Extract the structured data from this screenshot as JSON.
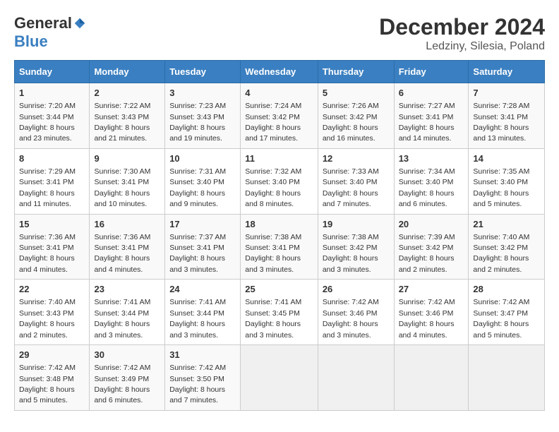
{
  "logo": {
    "general": "General",
    "blue": "Blue"
  },
  "title": "December 2024",
  "location": "Ledziny, Silesia, Poland",
  "days_of_week": [
    "Sunday",
    "Monday",
    "Tuesday",
    "Wednesday",
    "Thursday",
    "Friday",
    "Saturday"
  ],
  "weeks": [
    [
      {
        "day": "1",
        "sunrise": "7:20 AM",
        "sunset": "3:44 PM",
        "daylight": "8 hours and 23 minutes"
      },
      {
        "day": "2",
        "sunrise": "7:22 AM",
        "sunset": "3:43 PM",
        "daylight": "8 hours and 21 minutes"
      },
      {
        "day": "3",
        "sunrise": "7:23 AM",
        "sunset": "3:43 PM",
        "daylight": "8 hours and 19 minutes"
      },
      {
        "day": "4",
        "sunrise": "7:24 AM",
        "sunset": "3:42 PM",
        "daylight": "8 hours and 17 minutes"
      },
      {
        "day": "5",
        "sunrise": "7:26 AM",
        "sunset": "3:42 PM",
        "daylight": "8 hours and 16 minutes"
      },
      {
        "day": "6",
        "sunrise": "7:27 AM",
        "sunset": "3:41 PM",
        "daylight": "8 hours and 14 minutes"
      },
      {
        "day": "7",
        "sunrise": "7:28 AM",
        "sunset": "3:41 PM",
        "daylight": "8 hours and 13 minutes"
      }
    ],
    [
      {
        "day": "8",
        "sunrise": "7:29 AM",
        "sunset": "3:41 PM",
        "daylight": "8 hours and 11 minutes"
      },
      {
        "day": "9",
        "sunrise": "7:30 AM",
        "sunset": "3:41 PM",
        "daylight": "8 hours and 10 minutes"
      },
      {
        "day": "10",
        "sunrise": "7:31 AM",
        "sunset": "3:40 PM",
        "daylight": "8 hours and 9 minutes"
      },
      {
        "day": "11",
        "sunrise": "7:32 AM",
        "sunset": "3:40 PM",
        "daylight": "8 hours and 8 minutes"
      },
      {
        "day": "12",
        "sunrise": "7:33 AM",
        "sunset": "3:40 PM",
        "daylight": "8 hours and 7 minutes"
      },
      {
        "day": "13",
        "sunrise": "7:34 AM",
        "sunset": "3:40 PM",
        "daylight": "8 hours and 6 minutes"
      },
      {
        "day": "14",
        "sunrise": "7:35 AM",
        "sunset": "3:40 PM",
        "daylight": "8 hours and 5 minutes"
      }
    ],
    [
      {
        "day": "15",
        "sunrise": "7:36 AM",
        "sunset": "3:41 PM",
        "daylight": "8 hours and 4 minutes"
      },
      {
        "day": "16",
        "sunrise": "7:36 AM",
        "sunset": "3:41 PM",
        "daylight": "8 hours and 4 minutes"
      },
      {
        "day": "17",
        "sunrise": "7:37 AM",
        "sunset": "3:41 PM",
        "daylight": "8 hours and 3 minutes"
      },
      {
        "day": "18",
        "sunrise": "7:38 AM",
        "sunset": "3:41 PM",
        "daylight": "8 hours and 3 minutes"
      },
      {
        "day": "19",
        "sunrise": "7:38 AM",
        "sunset": "3:42 PM",
        "daylight": "8 hours and 3 minutes"
      },
      {
        "day": "20",
        "sunrise": "7:39 AM",
        "sunset": "3:42 PM",
        "daylight": "8 hours and 2 minutes"
      },
      {
        "day": "21",
        "sunrise": "7:40 AM",
        "sunset": "3:42 PM",
        "daylight": "8 hours and 2 minutes"
      }
    ],
    [
      {
        "day": "22",
        "sunrise": "7:40 AM",
        "sunset": "3:43 PM",
        "daylight": "8 hours and 2 minutes"
      },
      {
        "day": "23",
        "sunrise": "7:41 AM",
        "sunset": "3:44 PM",
        "daylight": "8 hours and 3 minutes"
      },
      {
        "day": "24",
        "sunrise": "7:41 AM",
        "sunset": "3:44 PM",
        "daylight": "8 hours and 3 minutes"
      },
      {
        "day": "25",
        "sunrise": "7:41 AM",
        "sunset": "3:45 PM",
        "daylight": "8 hours and 3 minutes"
      },
      {
        "day": "26",
        "sunrise": "7:42 AM",
        "sunset": "3:46 PM",
        "daylight": "8 hours and 3 minutes"
      },
      {
        "day": "27",
        "sunrise": "7:42 AM",
        "sunset": "3:46 PM",
        "daylight": "8 hours and 4 minutes"
      },
      {
        "day": "28",
        "sunrise": "7:42 AM",
        "sunset": "3:47 PM",
        "daylight": "8 hours and 5 minutes"
      }
    ],
    [
      {
        "day": "29",
        "sunrise": "7:42 AM",
        "sunset": "3:48 PM",
        "daylight": "8 hours and 5 minutes"
      },
      {
        "day": "30",
        "sunrise": "7:42 AM",
        "sunset": "3:49 PM",
        "daylight": "8 hours and 6 minutes"
      },
      {
        "day": "31",
        "sunrise": "7:42 AM",
        "sunset": "3:50 PM",
        "daylight": "8 hours and 7 minutes"
      },
      null,
      null,
      null,
      null
    ]
  ]
}
